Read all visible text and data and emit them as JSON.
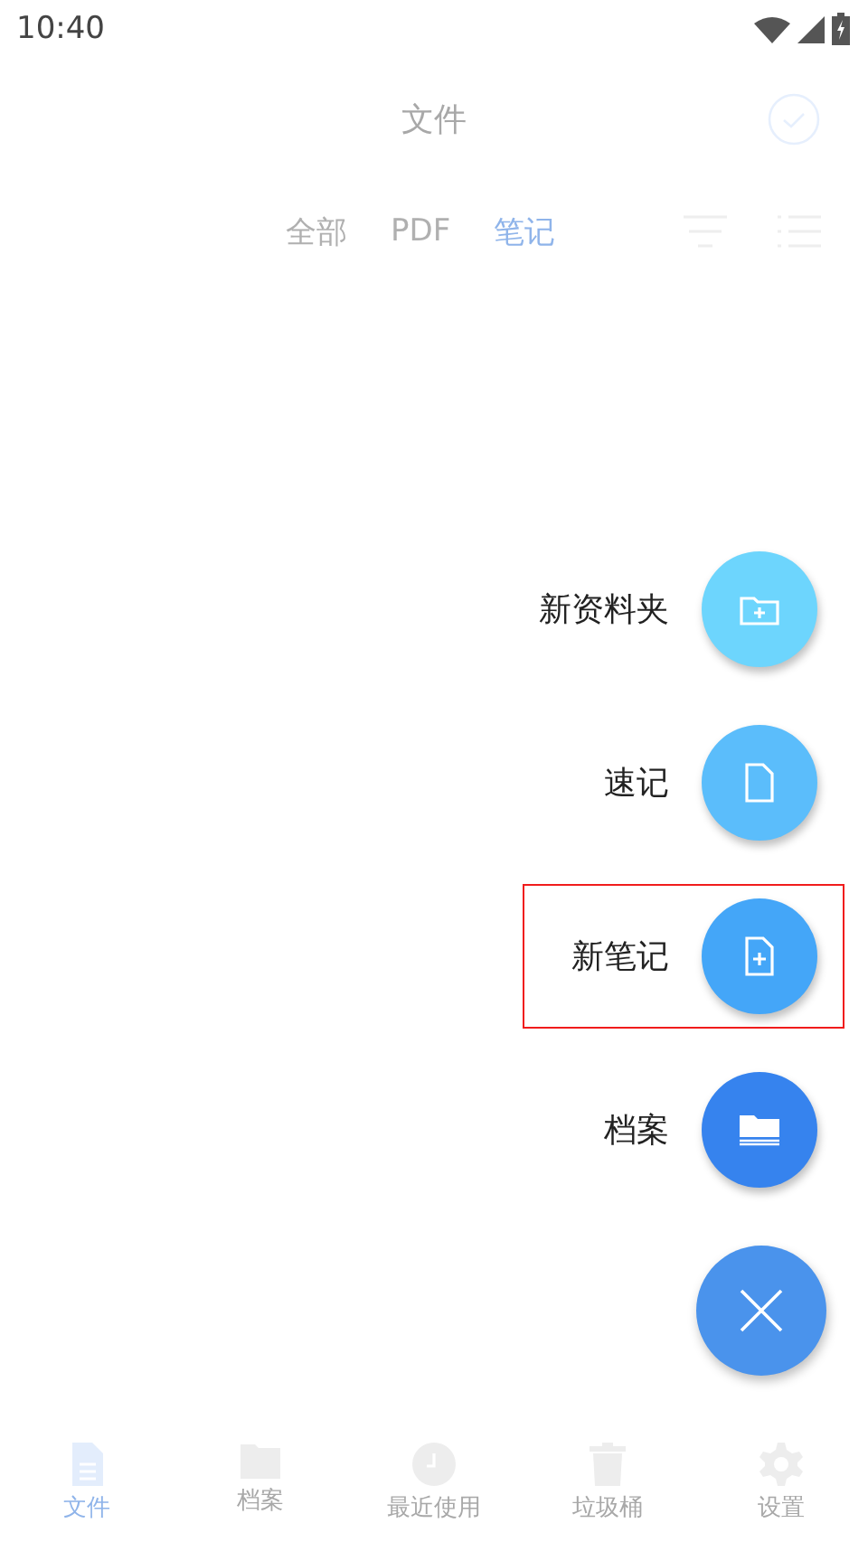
{
  "status_bar": {
    "time": "10:40"
  },
  "header": {
    "title": "文件"
  },
  "tabs": [
    {
      "label": "全部",
      "selected": false
    },
    {
      "label": "PDF",
      "selected": false
    },
    {
      "label": "笔记",
      "selected": true
    }
  ],
  "speed_dial": [
    {
      "kind": "folder-plus",
      "label": "新资料夹",
      "color": "#6dd5fd",
      "highlighted": false
    },
    {
      "kind": "page",
      "label": "速记",
      "color": "#5bbdfb",
      "highlighted": false
    },
    {
      "kind": "page-plus",
      "label": "新笔记",
      "color": "#44a6f8",
      "highlighted": true
    },
    {
      "kind": "archive",
      "label": "档案",
      "color": "#3683ee",
      "highlighted": false
    }
  ],
  "bottom_nav": [
    {
      "kind": "file",
      "label": "文件",
      "selected": true
    },
    {
      "kind": "folder",
      "label": "档案",
      "selected": false
    },
    {
      "kind": "clock",
      "label": "最近使用",
      "selected": false
    },
    {
      "kind": "trash",
      "label": "垃圾桶",
      "selected": false
    },
    {
      "kind": "gear",
      "label": "设置",
      "selected": false
    }
  ]
}
